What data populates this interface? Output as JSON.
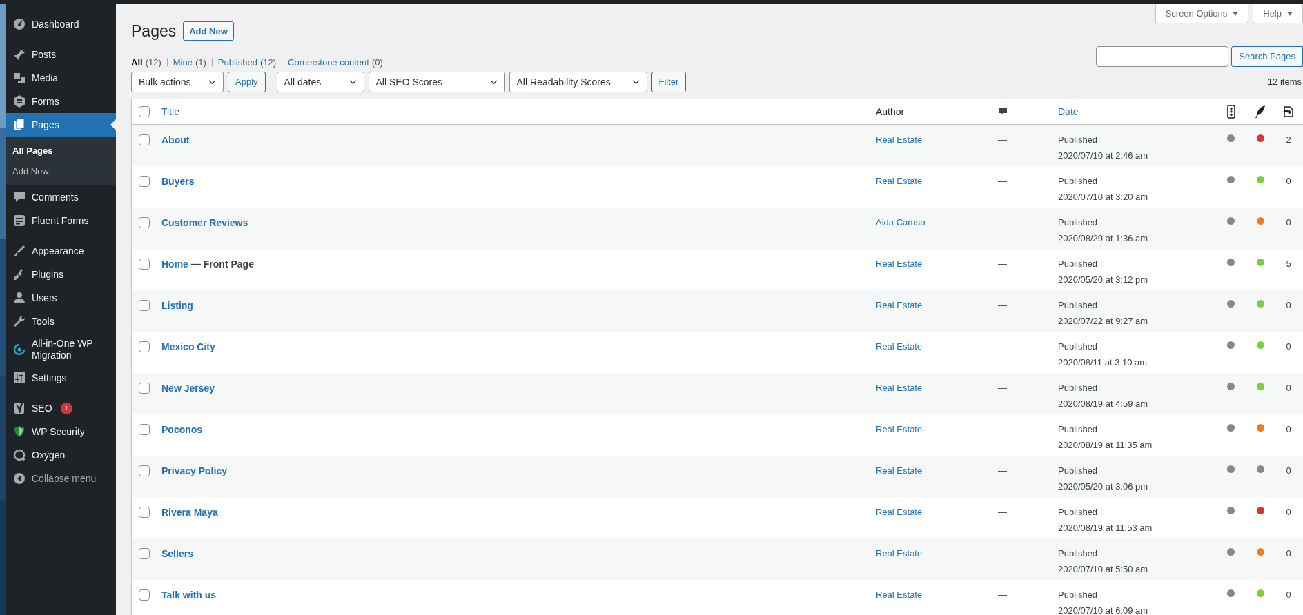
{
  "sidebar": {
    "groups": [
      [
        {
          "label": "Dashboard",
          "selected": false
        }
      ],
      [
        {
          "label": "Posts",
          "selected": false
        },
        {
          "label": "Media",
          "selected": false
        },
        {
          "label": "Forms",
          "selected": false
        },
        {
          "label": "Pages",
          "selected": true,
          "submenu": [
            {
              "label": "All Pages",
              "selected": true
            },
            {
              "label": "Add New",
              "selected": false
            }
          ]
        },
        {
          "label": "Comments",
          "selected": false
        },
        {
          "label": "Fluent Forms",
          "selected": false
        }
      ],
      [
        {
          "label": "Appearance",
          "selected": false
        },
        {
          "label": "Plugins",
          "selected": false
        },
        {
          "label": "Users",
          "selected": false
        },
        {
          "label": "Tools",
          "selected": false
        },
        {
          "label": "All-in-One WP Migration",
          "selected": false
        },
        {
          "label": "Settings",
          "selected": false
        }
      ],
      [
        {
          "label": "SEO",
          "selected": false,
          "badge": "1"
        },
        {
          "label": "WP Security",
          "selected": false
        },
        {
          "label": "Oxygen",
          "selected": false
        },
        {
          "label": "Collapse menu",
          "selected": false,
          "kind": "collapse"
        }
      ]
    ]
  },
  "screen_tabs": [
    "Screen Options",
    "Help"
  ],
  "page_title": "Pages",
  "add_new": "Add New",
  "views": [
    {
      "label": "All",
      "count": "(12)",
      "selected": true
    },
    {
      "label": "Mine",
      "count": "(1)",
      "selected": false
    },
    {
      "label": "Published",
      "count": "(12)",
      "selected": false
    },
    {
      "label": "Cornerstone content",
      "count": "(0)",
      "selected": false
    }
  ],
  "search": {
    "button": "Search Pages"
  },
  "filters": {
    "bulk": "Bulk actions",
    "apply": "Apply",
    "dropdowns": [
      "All dates",
      "All SEO Scores",
      "All Readability Scores"
    ],
    "filter": "Filter"
  },
  "items_count": "12 items",
  "table": {
    "columns": {
      "title": "Title",
      "author": "Author",
      "date": "Date"
    },
    "select_all_checked": false,
    "rows": [
      {
        "checked": false,
        "title": "About",
        "author": "Real Estate",
        "comments": "—",
        "status": "Published",
        "date": "2020/07/10 at 2:46 am",
        "seo": {
          "color": "#888888"
        },
        "readability": {
          "color": "#dc3232"
        },
        "links": "2"
      },
      {
        "checked": false,
        "title": "Buyers",
        "author": "Real Estate",
        "comments": "—",
        "status": "Published",
        "date": "2020/07/10 at 3:20 am",
        "seo": {
          "color": "#888888"
        },
        "readability": {
          "color": "#7ad03a"
        },
        "links": "0"
      },
      {
        "checked": false,
        "title": "Customer Reviews",
        "author": "Aida Caruso",
        "comments": "—",
        "status": "Published",
        "date": "2020/08/29 at 1:36 am",
        "seo": {
          "color": "#888888"
        },
        "readability": {
          "color": "#ee7c1b"
        },
        "links": "0"
      },
      {
        "checked": false,
        "title": "Home",
        "state": "— Front Page",
        "author": "Real Estate",
        "comments": "—",
        "status": "Published",
        "date": "2020/05/20 at 3:12 pm",
        "seo": {
          "color": "#888888"
        },
        "readability": {
          "color": "#7ad03a"
        },
        "links": "5"
      },
      {
        "checked": false,
        "title": "Listing",
        "author": "Real Estate",
        "comments": "—",
        "status": "Published",
        "date": "2020/07/22 at 9:27 am",
        "seo": {
          "color": "#888888"
        },
        "readability": {
          "color": "#7ad03a"
        },
        "links": "0"
      },
      {
        "checked": false,
        "title": "Mexico City",
        "author": "Real Estate",
        "comments": "—",
        "status": "Published",
        "date": "2020/08/11 at 3:10 am",
        "seo": {
          "color": "#888888"
        },
        "readability": {
          "color": "#7ad03a"
        },
        "links": "0"
      },
      {
        "checked": false,
        "title": "New Jersey",
        "author": "Real Estate",
        "comments": "—",
        "status": "Published",
        "date": "2020/08/19 at 4:59 am",
        "seo": {
          "color": "#888888"
        },
        "readability": {
          "color": "#7ad03a"
        },
        "links": "0"
      },
      {
        "checked": false,
        "title": "Poconos",
        "author": "Real Estate",
        "comments": "—",
        "status": "Published",
        "date": "2020/08/19 at 11:35 am",
        "seo": {
          "color": "#888888"
        },
        "readability": {
          "color": "#ee7c1b"
        },
        "links": "0"
      },
      {
        "checked": false,
        "title": "Privacy Policy",
        "author": "Real Estate",
        "comments": "—",
        "status": "Published",
        "date": "2020/05/20 at 3:06 pm",
        "seo": {
          "color": "#888888"
        },
        "readability": {
          "color": "#888888"
        },
        "links": "0"
      },
      {
        "checked": false,
        "title": "Rivera Maya",
        "author": "Real Estate",
        "comments": "—",
        "status": "Published",
        "date": "2020/08/19 at 11:53 am",
        "seo": {
          "color": "#888888"
        },
        "readability": {
          "color": "#dc3232"
        },
        "links": "0"
      },
      {
        "checked": false,
        "title": "Sellers",
        "author": "Real Estate",
        "comments": "—",
        "status": "Published",
        "date": "2020/07/10 at 5:50 am",
        "seo": {
          "color": "#888888"
        },
        "readability": {
          "color": "#ee7c1b"
        },
        "links": "0"
      },
      {
        "checked": false,
        "title": "Talk with us",
        "author": "Real Estate",
        "comments": "—",
        "status": "Published",
        "date": "2020/07/10 at 6:09 am",
        "seo": {
          "color": "#888888"
        },
        "readability": {
          "color": "#7ad03a"
        },
        "links": "0"
      }
    ]
  }
}
